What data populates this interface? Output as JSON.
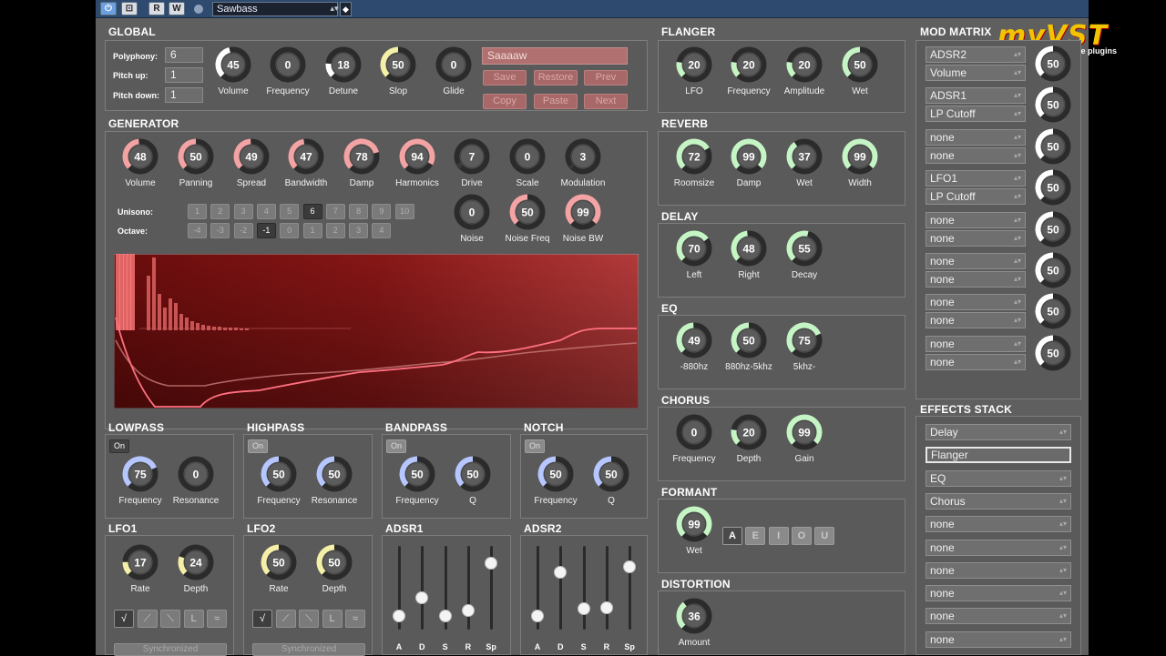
{
  "topbar": {
    "buttons": [
      "⏻",
      "⊡",
      "R",
      "W"
    ],
    "preset": "Sawbass"
  },
  "logo": {
    "main": "myVST",
    "sub": "free plugins"
  },
  "sections": {
    "global": "GLOBAL",
    "generator": "GENERATOR",
    "lowpass": "LOWPASS",
    "highpass": "HIGHPASS",
    "bandpass": "BANDPASS",
    "notch": "NOTCH",
    "lfo1": "LFO1",
    "lfo2": "LFO2",
    "adsr1": "ADSR1",
    "adsr2": "ADSR2",
    "flanger": "FLANGER",
    "reverb": "REVERB",
    "delay": "DELAY",
    "eq": "EQ",
    "chorus": "CHORUS",
    "formant": "FORMANT",
    "distortion": "DISTORTION",
    "mod_matrix": "MOD MATRIX",
    "effects_stack": "EFFECTS STACK"
  },
  "global": {
    "polyphony_label": "Polyphony:",
    "polyphony": "6",
    "pitch_up_label": "Pitch up:",
    "pitch_up": "1",
    "pitch_down_label": "Pitch down:",
    "pitch_down": "1",
    "patch_name": "Saaaaw",
    "buttons": [
      "Save",
      "Restore",
      "Prev",
      "Copy",
      "Paste",
      "Next"
    ],
    "knobs": [
      {
        "label": "Volume",
        "value": "45"
      },
      {
        "label": "Frequency",
        "value": "0"
      },
      {
        "label": "Detune",
        "value": "18"
      },
      {
        "label": "Slop",
        "value": "50"
      },
      {
        "label": "Glide",
        "value": "0"
      }
    ]
  },
  "generator": {
    "knobs": [
      {
        "label": "Volume",
        "value": "48"
      },
      {
        "label": "Panning",
        "value": "50"
      },
      {
        "label": "Spread",
        "value": "49"
      },
      {
        "label": "Bandwidth",
        "value": "47"
      },
      {
        "label": "Damp",
        "value": "78"
      },
      {
        "label": "Harmonics",
        "value": "94"
      },
      {
        "label": "Drive",
        "value": "7"
      },
      {
        "label": "Scale",
        "value": "0"
      },
      {
        "label": "Modulation",
        "value": "3"
      }
    ],
    "noise_knobs": [
      {
        "label": "Noise",
        "value": "0"
      },
      {
        "label": "Noise Freq",
        "value": "50"
      },
      {
        "label": "Noise BW",
        "value": "99"
      }
    ],
    "unisono_label": "Unisono:",
    "unisono": [
      "1",
      "2",
      "3",
      "4",
      "5",
      "6",
      "7",
      "8",
      "9",
      "10"
    ],
    "unisono_selected": 5,
    "octave_label": "Octave:",
    "octave": [
      "-4",
      "-3",
      "-2",
      "-1",
      "0",
      "1",
      "2",
      "3",
      "4"
    ],
    "octave_selected": 3
  },
  "filters": {
    "on_label": "On",
    "lowpass": [
      {
        "label": "Frequency",
        "value": "75"
      },
      {
        "label": "Resonance",
        "value": "0"
      }
    ],
    "highpass": [
      {
        "label": "Frequency",
        "value": "50"
      },
      {
        "label": "Resonance",
        "value": "50"
      }
    ],
    "bandpass": [
      {
        "label": "Frequency",
        "value": "50"
      },
      {
        "label": "Q",
        "value": "50"
      }
    ],
    "notch": [
      {
        "label": "Frequency",
        "value": "50"
      },
      {
        "label": "Q",
        "value": "50"
      }
    ]
  },
  "lfo": {
    "lfo1": [
      {
        "label": "Rate",
        "value": "17"
      },
      {
        "label": "Depth",
        "value": "24"
      }
    ],
    "lfo2": [
      {
        "label": "Rate",
        "value": "50"
      },
      {
        "label": "Depth",
        "value": "50"
      }
    ],
    "waveforms": [
      "√",
      "⟋",
      "⟍",
      "L",
      "≈"
    ],
    "sync_label": "Synchronized"
  },
  "adsr": {
    "labels": [
      "A",
      "D",
      "S",
      "R",
      "Sp"
    ],
    "adsr1_levels": [
      0.12,
      0.38,
      0.12,
      0.2,
      0.85
    ],
    "adsr2_levels": [
      0.12,
      0.72,
      0.22,
      0.24,
      0.8
    ]
  },
  "effects": {
    "flanger": [
      {
        "label": "LFO",
        "value": "20"
      },
      {
        "label": "Frequency",
        "value": "20"
      },
      {
        "label": "Amplitude",
        "value": "20"
      },
      {
        "label": "Wet",
        "value": "50"
      }
    ],
    "reverb": [
      {
        "label": "Roomsize",
        "value": "72"
      },
      {
        "label": "Damp",
        "value": "99"
      },
      {
        "label": "Wet",
        "value": "37"
      },
      {
        "label": "Width",
        "value": "99"
      }
    ],
    "delay": [
      {
        "label": "Left",
        "value": "70"
      },
      {
        "label": "Right",
        "value": "48"
      },
      {
        "label": "Decay",
        "value": "55"
      }
    ],
    "eq": [
      {
        "label": "-880hz",
        "value": "49"
      },
      {
        "label": "880hz-5khz",
        "value": "50"
      },
      {
        "label": "5khz-",
        "value": "75"
      }
    ],
    "chorus": [
      {
        "label": "Frequency",
        "value": "0"
      },
      {
        "label": "Depth",
        "value": "20"
      },
      {
        "label": "Gain",
        "value": "99"
      }
    ],
    "formant": [
      {
        "label": "Wet",
        "value": "99"
      }
    ],
    "formant_vowels": [
      "A",
      "E",
      "I",
      "O",
      "U"
    ],
    "distortion": [
      {
        "label": "Amount",
        "value": "36"
      }
    ]
  },
  "mod_matrix": [
    {
      "source": "ADSR2",
      "target": "Volume",
      "value": "50"
    },
    {
      "source": "ADSR1",
      "target": "LP Cutoff",
      "value": "50"
    },
    {
      "source": "none",
      "target": "none",
      "value": "50"
    },
    {
      "source": "LFO1",
      "target": "LP Cutoff",
      "value": "50"
    },
    {
      "source": "none",
      "target": "none",
      "value": "50"
    },
    {
      "source": "none",
      "target": "none",
      "value": "50"
    },
    {
      "source": "none",
      "target": "none",
      "value": "50"
    },
    {
      "source": "none",
      "target": "none",
      "value": "50"
    }
  ],
  "effects_stack": [
    "Delay",
    "Flanger",
    "EQ",
    "Chorus",
    "none",
    "none",
    "none",
    "none",
    "none",
    "none"
  ],
  "effects_stack_selected": 1,
  "colors": {
    "background": "#5f5f5f",
    "pink_knob": "#f3a3a3",
    "blue_knob": "#b6c6ff",
    "green_knob": "#c5f5c5",
    "yellow_knob": "#f5f0a8",
    "spectrum_bg": "#7a1212",
    "spectrum_line": "#ff6b7a"
  }
}
